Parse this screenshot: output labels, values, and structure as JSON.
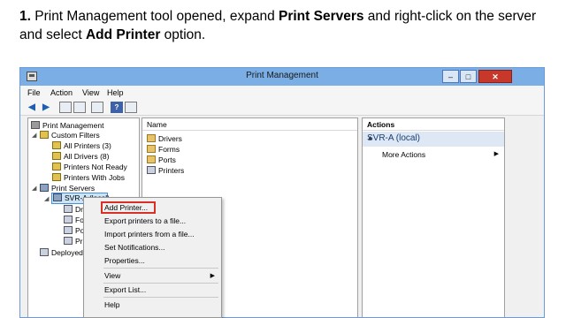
{
  "instruction": {
    "step_number": "1.",
    "part1": " Print Management tool opened, expand ",
    "bold1": "Print Servers",
    "part2": " and right-click on the server and select ",
    "bold2": "Add Printer",
    "part3": " option."
  },
  "window": {
    "title": "Print Management",
    "minimize_glyph": "–",
    "maximize_glyph": "□",
    "close_glyph": "✕"
  },
  "menubar": {
    "items": [
      "File",
      "Action",
      "View",
      "Help"
    ]
  },
  "toolbar": {
    "back_glyph": "◀",
    "forward_glyph": "▶",
    "help_glyph": "?"
  },
  "tree": {
    "root": "Print Management",
    "custom_filters": "Custom Filters",
    "all_printers": "All Printers (3)",
    "all_drivers": "All Drivers (8)",
    "printers_not_ready": "Printers Not Ready",
    "printers_with_jobs": "Printers With Jobs",
    "print_servers": "Print Servers",
    "server": "SVR-A (local)",
    "child_dr": "Dr",
    "child_fo": "Fo",
    "child_po": "Po",
    "child_pr": "Pr",
    "deployed": "Deployed"
  },
  "list": {
    "column_header": "Name",
    "items": [
      "Drivers",
      "Forms",
      "Ports",
      "Printers"
    ]
  },
  "actions": {
    "header": "Actions",
    "group": "SVR-A (local)",
    "item": "More Actions"
  },
  "context_menu": {
    "add_printer": "Add Printer...",
    "export_printers": "Export printers to a file...",
    "import_printers": "Import printers from a file...",
    "set_notifications": "Set Notifications...",
    "properties": "Properties...",
    "view": "View",
    "export_list": "Export List...",
    "help": "Help"
  },
  "colors": {
    "titlebar": "#7aaee4",
    "selection": "#cce4f7",
    "highlight_border": "#d93025",
    "actions_group": "#dde8f4"
  }
}
